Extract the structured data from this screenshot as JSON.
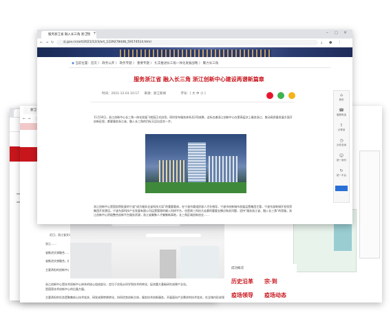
{
  "front": {
    "tab_title": "服务浙江省 融入长三角 浙江创",
    "url": "zj.gov.cn/art/2021/12/3/art_1229278448_59174514.html",
    "breadcrumb": [
      "当前位置：首页",
      "政务公开",
      "政务专题",
      "重要专题",
      "扎实推进长三角一体化发展战略",
      "聚力长三角"
    ],
    "title": "服务浙江省 融入长三角 浙江创新中心建设再谱新篇章",
    "meta_date": "时间：2021-12-03 10:17",
    "meta_source": "来源：浙江新闻",
    "font_size_label": "字号：[ 大 中 小 ]",
    "para1": "11月30日，浙江创新中心长三角一体化发展飞地园正式启用，同时发布服务体系及2项成果，这标志着浙江创新中心在更高层次上服务浙江、推动高质量发展方面开启新征程，都要服务浙江省、融入长三角的目标又迈出坚实一步。",
    "para2": "浙江创新中心是国务院批复的宁波“成为服务全省科技大局”的重要载体，在宁波市委组织部人才办指导，宁波市创新城市发展运营集团主管，宁波东部新城开发投资集团开发建设。宁波东部科技产业发展有限公司运营管理的输入科研平台，也是周三科技大走廊的重要支撑点和关问题，坚持“服务浙江省、融入长三角”的思路，浙江创新中心积极整合创新平台服务资源，浙江省集聚人才集聚新高地，长三角区域创新创业……",
    "sidebar": [
      {
        "icon": "home-icon",
        "label": "首页"
      },
      {
        "icon": "phone-icon",
        "label": "客服电话"
      },
      {
        "icon": "share-icon",
        "label": "分享到"
      },
      {
        "icon": "clock-icon",
        "label": "办件查询"
      },
      {
        "icon": "user-icon",
        "label": "统一身份"
      },
      {
        "icon": "refresh-icon",
        "label": "统一平台"
      },
      {
        "icon": "top-icon",
        "label": "TOP"
      }
    ]
  },
  "middle": {
    "tab_title": "浙江省",
    "para1": "近日，浙江省文化和旅游厅……",
    "para2": "浙江……",
    "para3": "省推进文旅融合……",
    "para4": "省推进文旅融合，促进文化和旅游深度融合……",
    "para5": "主要承担的创新中心技术的……",
    "para6": "浙江创新中心是技术创新中心体系的核心组成部分，定位于实现从科学到技术的转化，促进重大基础研究成果产业化。",
    "para7": "是国家技术创新中心的后备力量。",
    "para8": "主要承担的任务是聚集核心技术攻关、研发成果转移转化，协同优势创新主体，服务技术创新服务，开展面向产业需求的技术攻关，在全域内形成领先优势。",
    "photo_heading": "成功概况",
    "red_labels": [
      "历史沿革",
      "宗·到",
      "疫场领导",
      "疫场动态"
    ]
  },
  "colors": {
    "accent_red": "#c8161d",
    "link_blue": "#2a6fd6",
    "chrome_gray": "#dfe1e5"
  }
}
